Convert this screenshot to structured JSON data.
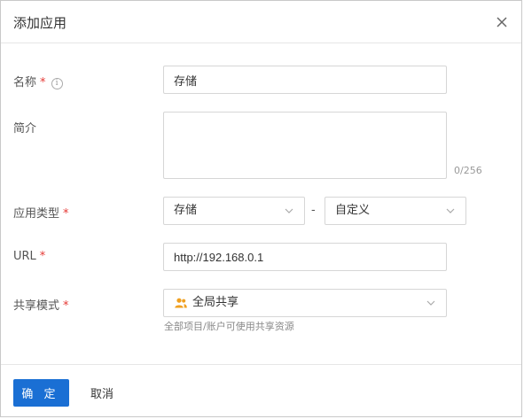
{
  "dialog": {
    "title": "添加应用",
    "close_icon": "close-icon"
  },
  "form": {
    "name": {
      "label": "名称",
      "required_mark": "*",
      "info_icon": "info-icon",
      "value": "存储"
    },
    "description": {
      "label": "简介",
      "value": "",
      "counter": "0/256"
    },
    "app_type": {
      "label": "应用类型",
      "required_mark": "*",
      "primary_value": "存储",
      "separator": "-",
      "secondary_value": "自定义"
    },
    "url": {
      "label": "URL",
      "required_mark": "*",
      "value": "http://192.168.0.1"
    },
    "share_mode": {
      "label": "共享模式",
      "required_mark": "*",
      "value": "全局共享",
      "icon": "users-icon",
      "hint": "全部项目/账户可使用共享资源"
    }
  },
  "footer": {
    "ok_label": "确 定",
    "cancel_label": "取消"
  },
  "colors": {
    "primary": "#1a6fd4",
    "required": "#e53935",
    "icon_orange": "#f0a020"
  }
}
